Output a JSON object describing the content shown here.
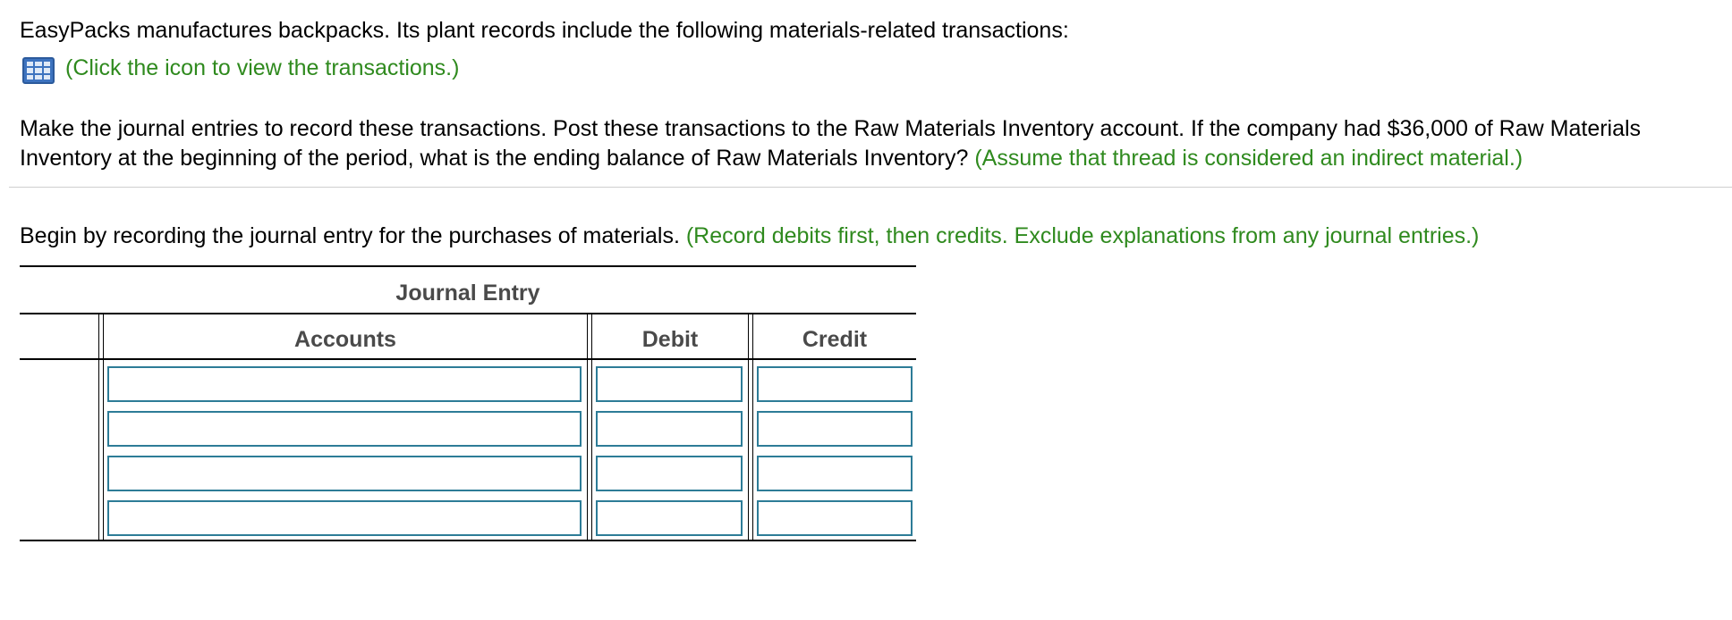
{
  "question": {
    "intro": "EasyPacks manufactures backpacks. Its plant records include the following materials-related transactions:",
    "icon_link_text": "(Click the icon to view the transactions.)",
    "instructions_line1": "Make the journal entries to record these transactions. Post these transactions to the Raw Materials Inventory account. If the company had $36,000 of Raw Materials",
    "instructions_line2_main": "Inventory at the beginning of the period, what is the ending balance of Raw Materials Inventory? ",
    "instructions_line2_note": "(Assume that thread is considered an indirect material.)",
    "step_main": "Begin by recording the journal entry for the purchases of materials. ",
    "step_note": "(Record debits first, then credits. Exclude explanations from any journal entries.)"
  },
  "journal": {
    "title": "Journal Entry",
    "columns": {
      "accounts": "Accounts",
      "debit": "Debit",
      "credit": "Credit"
    },
    "rows": [
      {
        "account": "",
        "debit": "",
        "credit": ""
      },
      {
        "account": "",
        "debit": "",
        "credit": ""
      },
      {
        "account": "",
        "debit": "",
        "credit": ""
      },
      {
        "account": "",
        "debit": "",
        "credit": ""
      }
    ]
  },
  "icons": {
    "transactions_icon": "table-grid-icon"
  },
  "colors": {
    "note_green": "#2f8a1e",
    "input_border": "#2d7c97",
    "icon_blue": "#3d73bf"
  }
}
